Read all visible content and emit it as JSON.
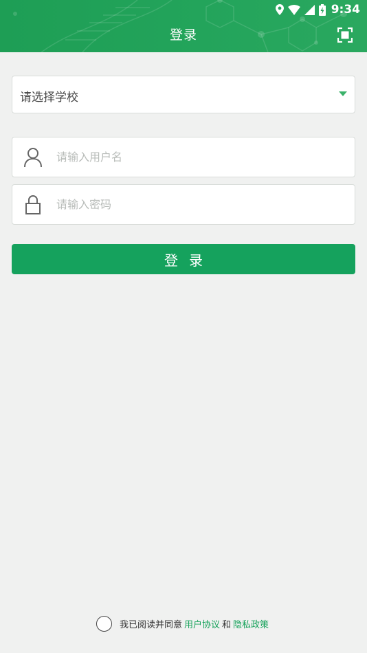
{
  "status_bar": {
    "time": "9:34"
  },
  "header": {
    "title": "登录"
  },
  "school_select": {
    "value": "请选择学校"
  },
  "username": {
    "placeholder": "请输入用户名"
  },
  "password": {
    "placeholder": "请输入密码"
  },
  "login_button": {
    "label": "登录"
  },
  "agreement": {
    "text": "我已阅读并同意",
    "user_agreement": "用户协议",
    "and": "和",
    "privacy_policy": "隐私政策"
  },
  "colors": {
    "accent": "#15a25d",
    "header": "#1e9e55",
    "background": "#f0f1f0"
  }
}
